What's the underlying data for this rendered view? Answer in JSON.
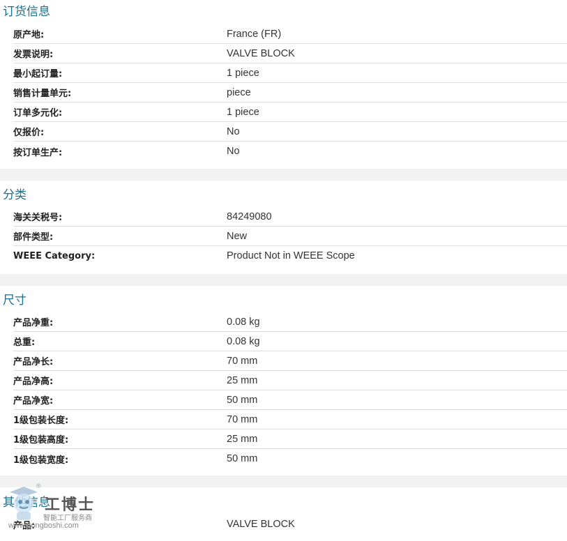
{
  "sections": [
    {
      "title": "订货信息",
      "rows": [
        {
          "label": "原产地:",
          "value": "France (FR)"
        },
        {
          "label": "发票说明:",
          "value": "VALVE BLOCK"
        },
        {
          "label": "最小起订量:",
          "value": "1 piece"
        },
        {
          "label": "销售计量单元:",
          "value": "piece"
        },
        {
          "label": "订单多元化:",
          "value": "1 piece"
        },
        {
          "label": "仅报价:",
          "value": "No"
        },
        {
          "label": "按订单生产:",
          "value": "No"
        }
      ]
    },
    {
      "title": "分类",
      "rows": [
        {
          "label": "海关关税号:",
          "value": "84249080"
        },
        {
          "label": "部件类型:",
          "value": "New"
        },
        {
          "label": "WEEE Category:",
          "value": "Product Not in WEEE Scope"
        }
      ]
    },
    {
      "title": "尺寸",
      "rows": [
        {
          "label": "产品净重:",
          "value": "0.08 kg"
        },
        {
          "label": "总重:",
          "value": "0.08 kg"
        },
        {
          "label": "产品净长:",
          "value": "70 mm"
        },
        {
          "label": "产品净高:",
          "value": "25 mm"
        },
        {
          "label": "产品净宽:",
          "value": "50 mm"
        },
        {
          "label": "1级包装长度:",
          "value": "70 mm"
        },
        {
          "label": "1级包装高度:",
          "value": "25 mm"
        },
        {
          "label": "1级包装宽度:",
          "value": "50 mm"
        }
      ]
    },
    {
      "title": "其他信息",
      "rows": [
        {
          "label": "产品:",
          "value": "VALVE BLOCK"
        }
      ]
    }
  ],
  "watermark": {
    "logo_text": "工博士",
    "registered": "®",
    "subtitle": "智能工厂服务商",
    "url": "www.gongboshi.com",
    "icon": "robot-mascot-icon"
  },
  "colors": {
    "section_title": "#1a6e8f",
    "divider": "#dcdcdc",
    "gap": "#f2f2f2"
  }
}
